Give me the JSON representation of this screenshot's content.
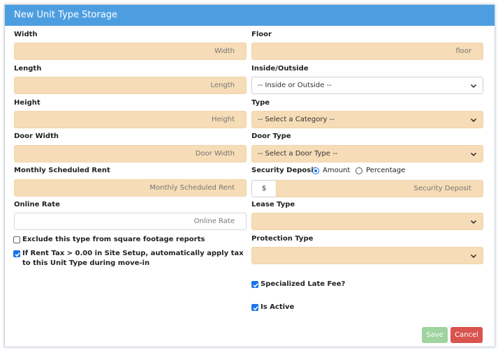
{
  "modal": {
    "title": "New Unit Type Storage"
  },
  "left": {
    "width": {
      "label": "Width",
      "placeholder": "Width"
    },
    "length": {
      "label": "Length",
      "placeholder": "Length"
    },
    "height": {
      "label": "Height",
      "placeholder": "Height"
    },
    "door_width": {
      "label": "Door Width",
      "placeholder": "Door Width"
    },
    "monthly_rent": {
      "label": "Monthly Scheduled Rent",
      "placeholder": "Monthly Scheduled Rent"
    },
    "online_rate": {
      "label": "Online Rate",
      "placeholder": "Online Rate"
    },
    "exclude_sqft": {
      "label": "Exclude this type from square footage reports",
      "checked": false
    },
    "rent_tax": {
      "label": "If Rent Tax > 0.00 in Site Setup, automatically apply tax to this Unit Type during move-in",
      "checked": true
    }
  },
  "right": {
    "floor": {
      "label": "Floor",
      "placeholder": "floor"
    },
    "inside_outside": {
      "label": "Inside/Outside",
      "value": "-- Inside or Outside --"
    },
    "type": {
      "label": "Type",
      "value": "-- Select a Category --"
    },
    "door_type": {
      "label": "Door Type",
      "value": "-- Select a Door Type --"
    },
    "security_deposit": {
      "label": "Security Deposit",
      "option_amount": "Amount",
      "option_percentage": "Percentage",
      "selected": "Amount",
      "prefix": "$",
      "placeholder": "Security Deposit"
    },
    "lease_type": {
      "label": "Lease Type",
      "value": ""
    },
    "protection_type": {
      "label": "Protection Type",
      "value": ""
    },
    "specialized_late_fee": {
      "label": "Specialized Late Fee?",
      "checked": true
    },
    "is_active": {
      "label": "Is Active",
      "checked": true
    }
  },
  "footer": {
    "save_label": "Save",
    "cancel_label": "Cancel"
  },
  "colors": {
    "header": "#4d9ee0",
    "input_fill": "#f6ddb7",
    "save": "#9fd39f",
    "cancel": "#d9534f"
  }
}
